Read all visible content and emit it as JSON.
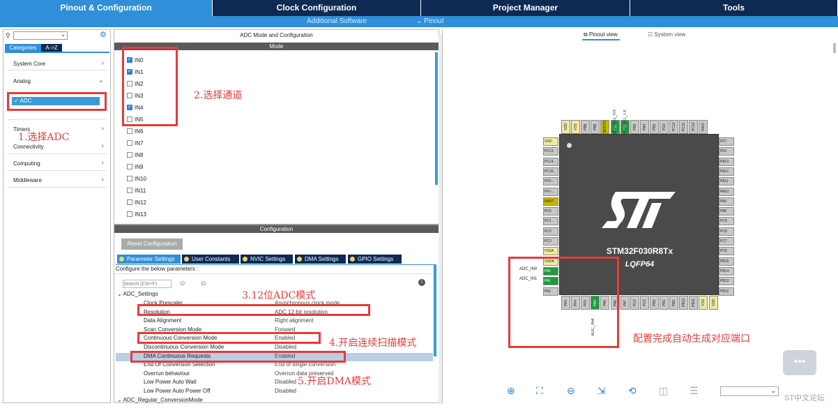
{
  "top_tabs": [
    "Pinout & Configuration",
    "Clock Configuration",
    "Project Manager",
    "Tools"
  ],
  "sub_bar": {
    "additional": "Additional Software",
    "pinout": "⌄ Pinout"
  },
  "left": {
    "tabs": [
      "Categories",
      "A->Z"
    ],
    "categories": [
      "System Core",
      "Analog",
      "ADC",
      "Timers",
      "Connectivity",
      "Computing",
      "Middleware"
    ]
  },
  "mid": {
    "mode_title": "ADC Mode and Configuration",
    "mode_bar": "Mode",
    "channels": [
      {
        "label": "IN0",
        "checked": true
      },
      {
        "label": "IN1",
        "checked": true
      },
      {
        "label": "IN2",
        "checked": false
      },
      {
        "label": "IN3",
        "checked": false
      },
      {
        "label": "IN4",
        "checked": true
      },
      {
        "label": "IN5",
        "checked": false
      },
      {
        "label": "IN6",
        "checked": false
      },
      {
        "label": "IN7",
        "checked": false
      },
      {
        "label": "IN8",
        "checked": false
      },
      {
        "label": "IN9",
        "checked": false
      },
      {
        "label": "IN10",
        "checked": false
      },
      {
        "label": "IN11",
        "checked": false
      },
      {
        "label": "IN12",
        "checked": false
      },
      {
        "label": "IN13",
        "checked": false
      }
    ],
    "config_bar": "Configuration",
    "reset_btn": "Reset Configuration",
    "settings_tabs": [
      "Parameter Settings",
      "User Constants",
      "NVIC Settings",
      "DMA Settings",
      "GPIO Settings"
    ],
    "configure_text": "Configure the below parameters :",
    "search_placeholder": "Search (Ctrl+F)",
    "group1": "ADC_Settings",
    "params": [
      {
        "name": "Clock Prescaler",
        "value": "Asynchronous clock mode"
      },
      {
        "name": "Resolution",
        "value": "ADC 12-bit resolution"
      },
      {
        "name": "Data Alignment",
        "value": "Right alignment"
      },
      {
        "name": "Scan Conversion Mode",
        "value": "Forward"
      },
      {
        "name": "Continuous Conversion Mode",
        "value": "Enabled"
      },
      {
        "name": "Discontinuous Conversion Mode",
        "value": "Disabled"
      },
      {
        "name": "DMA Continuous Requests",
        "value": "Enabled"
      },
      {
        "name": "End Of Conversion Selection",
        "value": "End of single conversion"
      },
      {
        "name": "Overrun behaviour",
        "value": "Overrun data preserved"
      },
      {
        "name": "Low Power Auto Wait",
        "value": "Disabled"
      },
      {
        "name": "Low Power Auto Power Off",
        "value": "Disabled"
      }
    ],
    "group2": "ADC_Regular_ConversionMode"
  },
  "annotations": {
    "a1": "1.选择ADC",
    "a2": "2.选择通道",
    "a3": "3.12位ADC模式",
    "a4": "4.开启连续扫描模式",
    "a5": "5.开启DMA模式",
    "a6": "配置完成自动生成对应端口"
  },
  "right": {
    "pinout_view": "Pinout view",
    "system_view": "System view",
    "chip_name": "STM32F030R8Tx",
    "package": "LQFP64",
    "top_pins": [
      "VDD",
      "VSS",
      "PB8",
      "PB9",
      "BOOT0",
      "PB7",
      "PB6",
      "PB5",
      "PB4",
      "PB3",
      "PD2",
      "PC12",
      "PC11",
      "PC10",
      "PA15"
    ],
    "top_pin_colors": [
      "y",
      "y",
      "n",
      "n",
      "o",
      "g",
      "g",
      "n",
      "n",
      "n",
      "n",
      "n",
      "n",
      "n",
      "n"
    ],
    "top_pin_labels": [
      "USART1_RX",
      "USART1_TX"
    ],
    "left_pins": [
      "VDD",
      "PC13",
      "PC14..",
      "PC15..",
      "PF0-..",
      "PF1-..",
      "NRST",
      "PC0",
      "PC1",
      "PC2",
      "PC3",
      "VSSA",
      "VDDA",
      "PA0",
      "PA1",
      "PA2"
    ],
    "left_pin_colors": [
      "y",
      "n",
      "n",
      "n",
      "n",
      "n",
      "o",
      "n",
      "n",
      "n",
      "n",
      "y",
      "y",
      "g",
      "g",
      "n"
    ],
    "left_pin_labels": [
      "ADC_IN0",
      "ADC_IN1"
    ],
    "right_pins": [
      "PF7",
      "PF6",
      "PA13",
      "PA12",
      "PA11",
      "PA10",
      "PA9",
      "PA8",
      "PC9",
      "PC8",
      "PC7",
      "PC6",
      "PB15",
      "PB14",
      "PB13",
      "PB12"
    ],
    "bottom_pins": [
      "PA3",
      "PF4",
      "PF5",
      "PA4",
      "PA5",
      "PA6",
      "PA7",
      "PC4",
      "PC5",
      "PB0",
      "PB1",
      "PB2",
      "PB10",
      "PB11",
      "VSS",
      "VDD"
    ],
    "bottom_pin_colors": [
      "n",
      "n",
      "n",
      "g",
      "n",
      "n",
      "n",
      "n",
      "n",
      "n",
      "n",
      "n",
      "n",
      "n",
      "y",
      "y"
    ],
    "bottom_pin_label": "ADC_IN4",
    "watermark": "ST中文论坛"
  }
}
